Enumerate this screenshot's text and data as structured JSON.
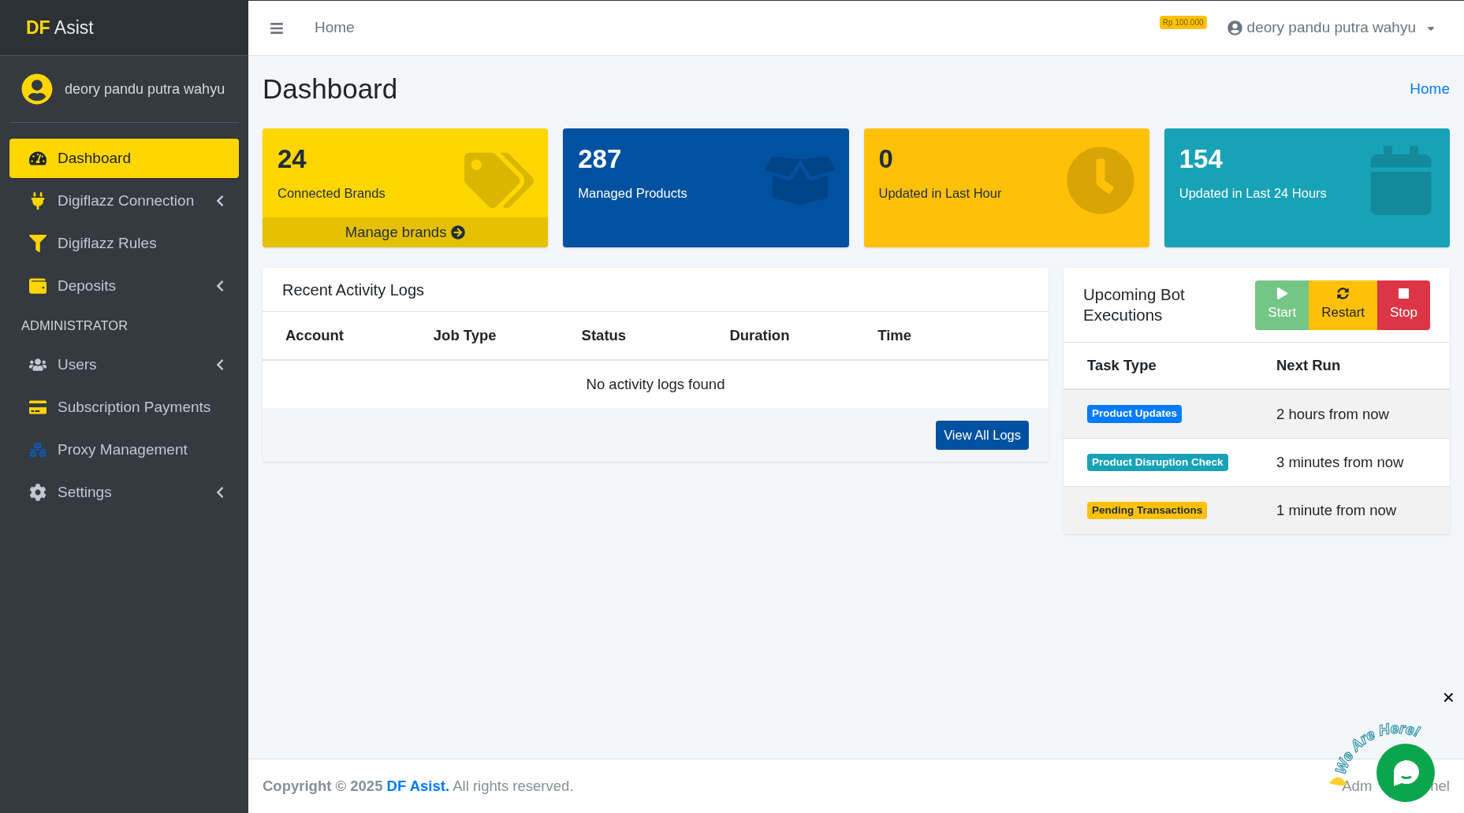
{
  "brand": {
    "bold": "DF",
    "rest": "Asist"
  },
  "sidebar": {
    "user": "deory pandu putra wahyu",
    "items": [
      {
        "kind": "item",
        "label": "Dashboard",
        "selected": true,
        "expandable": false
      },
      {
        "kind": "item",
        "label": "Digiflazz Connection",
        "selected": false,
        "expandable": true
      },
      {
        "kind": "item",
        "label": "Digiflazz Rules",
        "selected": false,
        "expandable": false
      },
      {
        "kind": "item",
        "label": "Deposits",
        "selected": false,
        "expandable": true
      },
      {
        "kind": "header",
        "label": "ADMINISTRATOR"
      },
      {
        "kind": "item",
        "label": "Users",
        "selected": false,
        "expandable": true
      },
      {
        "kind": "item",
        "label": "Subscription Payments",
        "selected": false,
        "expandable": false
      },
      {
        "kind": "item",
        "label": "Proxy Management",
        "selected": false,
        "expandable": false
      },
      {
        "kind": "item",
        "label": "Settings",
        "selected": false,
        "expandable": true
      }
    ]
  },
  "topbar": {
    "nav_link": "Home",
    "balance": "Rp 100.000",
    "user": "deory pandu putra wahyu"
  },
  "page": {
    "title": "Dashboard",
    "breadcrumb": "Home"
  },
  "cards": [
    {
      "value": "24",
      "label": "Connected Brands",
      "color": "#ffd600",
      "link": "Manage brands"
    },
    {
      "value": "287",
      "label": "Managed Products",
      "color": "#0051a0"
    },
    {
      "value": "0",
      "label": "Updated in Last Hour",
      "color": "#ffc107"
    },
    {
      "value": "154",
      "label": "Updated in Last 24 Hours",
      "color": "#17a2b8"
    }
  ],
  "activity": {
    "title": "Recent Activity Logs",
    "columns": [
      "Account",
      "Job Type",
      "Status",
      "Duration",
      "Time"
    ],
    "empty": "No activity logs found",
    "button": "View All Logs"
  },
  "bot": {
    "title": "Upcoming Bot Executions",
    "buttons": [
      {
        "kind": "start",
        "label": "Start"
      },
      {
        "kind": "restart",
        "label": "Restart"
      },
      {
        "kind": "stop",
        "label": "Stop"
      }
    ],
    "columns": [
      "Task Type",
      "Next Run"
    ],
    "rows": [
      {
        "task": "Product Updates",
        "color": "#007bff",
        "next_run": "2 hours from now"
      },
      {
        "task": "Product Disruption Check",
        "color": "#17a2b8",
        "next_run": "3 minutes from now"
      },
      {
        "task": "Pending Transactions",
        "color": "#ffc107",
        "next_run": "1 minute from now"
      }
    ]
  },
  "footer": {
    "prefix": "Copyright © 2025",
    "link": "DF Asist.",
    "suffix": "All rights reserved.",
    "right_parts": [
      "Adm",
      "nel"
    ]
  },
  "chat_widget": {
    "caption": "We Are Here!",
    "close": "×"
  }
}
